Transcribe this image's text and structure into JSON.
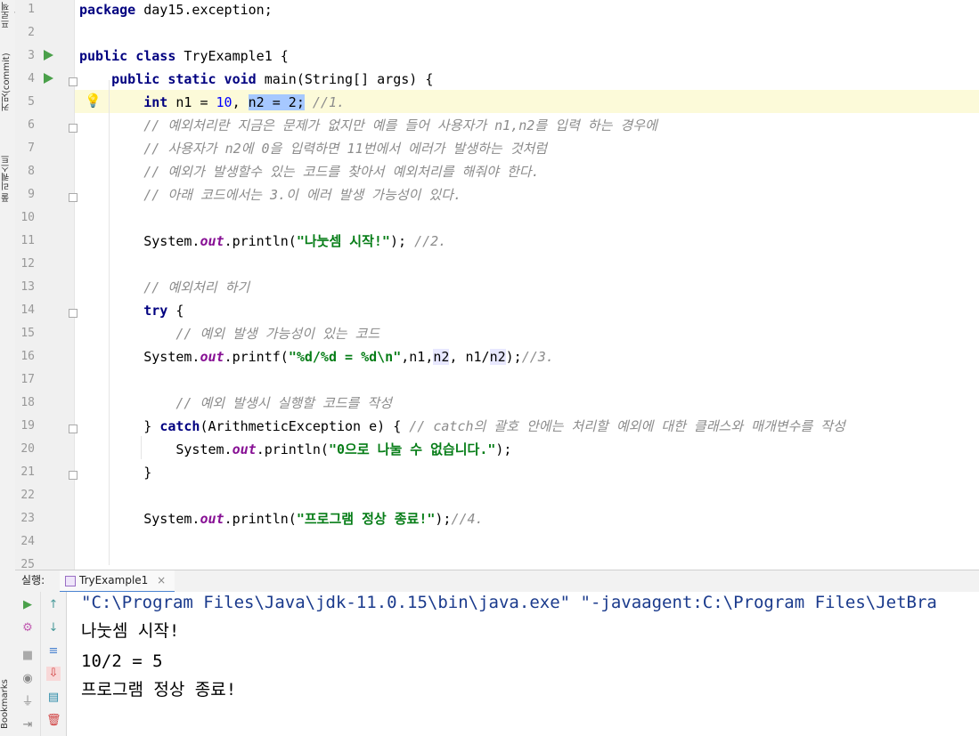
{
  "sidebar": {
    "tabs": [
      "커밋(commit)",
      "풀 리퀘스트",
      "Bookmarks"
    ],
    "top_tab": "프로젝트"
  },
  "editor": {
    "line_numbers": [
      "1",
      "2",
      "3",
      "4",
      "5",
      "6",
      "7",
      "8",
      "9",
      "10",
      "11",
      "12",
      "13",
      "14",
      "15",
      "16",
      "17",
      "18",
      "19",
      "20",
      "21",
      "22",
      "23",
      "24",
      "25"
    ],
    "lines": [
      [
        {
          "t": "package",
          "c": "kw"
        },
        {
          "t": " day15.exception;",
          "c": ""
        }
      ],
      [],
      [
        {
          "t": "public class",
          "c": "kw"
        },
        {
          "t": " TryExample1 {",
          "c": ""
        }
      ],
      [
        {
          "t": "    ",
          "c": ""
        },
        {
          "t": "public static void",
          "c": "kw"
        },
        {
          "t": " main(String[] args) {",
          "c": ""
        }
      ],
      [
        {
          "t": "        ",
          "c": ""
        },
        {
          "t": "int",
          "c": "kw"
        },
        {
          "t": " n1 = ",
          "c": ""
        },
        {
          "t": "10",
          "c": "num"
        },
        {
          "t": ", ",
          "c": ""
        },
        {
          "t": "n2 = 2;",
          "c": "sel"
        },
        {
          "t": " //1.",
          "c": "cmt"
        }
      ],
      [
        {
          "t": "        // 예외처리란 지금은 문제가 없지만 예를 들어 사용자가 n1,n2를 입력 하는 경우에",
          "c": "cmt"
        }
      ],
      [
        {
          "t": "        // 사용자가 n2에 0을 입력하면 11번에서 에러가 발생하는 것처럼",
          "c": "cmt"
        }
      ],
      [
        {
          "t": "        // 예외가 발생할수 있는 코드를 찾아서 예외처리를 해줘야 한다.",
          "c": "cmt"
        }
      ],
      [
        {
          "t": "        // 아래 코드에서는 3.이 에러 발생 가능성이 있다.",
          "c": "cmt"
        }
      ],
      [],
      [
        {
          "t": "        System.",
          "c": ""
        },
        {
          "t": "out",
          "c": "fld"
        },
        {
          "t": ".println(",
          "c": ""
        },
        {
          "t": "\"나눗셈 시작!\"",
          "c": "str"
        },
        {
          "t": "); ",
          "c": ""
        },
        {
          "t": "//2.",
          "c": "cmt"
        }
      ],
      [],
      [
        {
          "t": "        // 예외처리 하기",
          "c": "cmt"
        }
      ],
      [
        {
          "t": "        ",
          "c": ""
        },
        {
          "t": "try",
          "c": "kw"
        },
        {
          "t": " {",
          "c": ""
        }
      ],
      [
        {
          "t": "            // 예외 발생 가능성이 있는 코드",
          "c": "cmt"
        }
      ],
      [
        {
          "t": "        System.",
          "c": ""
        },
        {
          "t": "out",
          "c": "fld"
        },
        {
          "t": ".printf(",
          "c": ""
        },
        {
          "t": "\"%d/%d = %d\\n\"",
          "c": "str"
        },
        {
          "t": ",n1,",
          "c": ""
        },
        {
          "t": "n2",
          "c": "var-hl"
        },
        {
          "t": ", n1/",
          "c": ""
        },
        {
          "t": "n2",
          "c": "var-hl"
        },
        {
          "t": ");",
          "c": ""
        },
        {
          "t": "//3.",
          "c": "cmt"
        }
      ],
      [],
      [
        {
          "t": "            // 예외 발생시 실행할 코드를 작성",
          "c": "cmt"
        }
      ],
      [
        {
          "t": "        } ",
          "c": ""
        },
        {
          "t": "catch",
          "c": "kw"
        },
        {
          "t": "(ArithmeticException e) { ",
          "c": ""
        },
        {
          "t": "// catch의 괄호 안에는 처리할 예외에 대한 클래스와 매개변수를 작성",
          "c": "cmt"
        }
      ],
      [
        {
          "t": "            System.",
          "c": ""
        },
        {
          "t": "out",
          "c": "fld"
        },
        {
          "t": ".println(",
          "c": ""
        },
        {
          "t": "\"0으로 나눌 수 없습니다.\"",
          "c": "str"
        },
        {
          "t": ");",
          "c": ""
        }
      ],
      [
        {
          "t": "        }",
          "c": ""
        }
      ],
      [],
      [
        {
          "t": "        System.",
          "c": ""
        },
        {
          "t": "out",
          "c": "fld"
        },
        {
          "t": ".println(",
          "c": ""
        },
        {
          "t": "\"프로그램 정상 종료!\"",
          "c": "str"
        },
        {
          "t": ");",
          "c": ""
        },
        {
          "t": "//4.",
          "c": "cmt"
        }
      ],
      [],
      []
    ]
  },
  "run_panel": {
    "label": "실행:",
    "tab_name": "TryExample1",
    "tab_close": "×",
    "output": [
      "\"C:\\Program Files\\Java\\jdk-11.0.15\\bin\\java.exe\" \"-javaagent:C:\\Program Files\\JetBra",
      "나눗셈 시작!",
      "10/2 = 5",
      "프로그램 정상 종료!"
    ]
  },
  "colors": {
    "run_green": "#4aa04a",
    "selection": "#a6c8ff",
    "current_line": "#fcfad9"
  }
}
